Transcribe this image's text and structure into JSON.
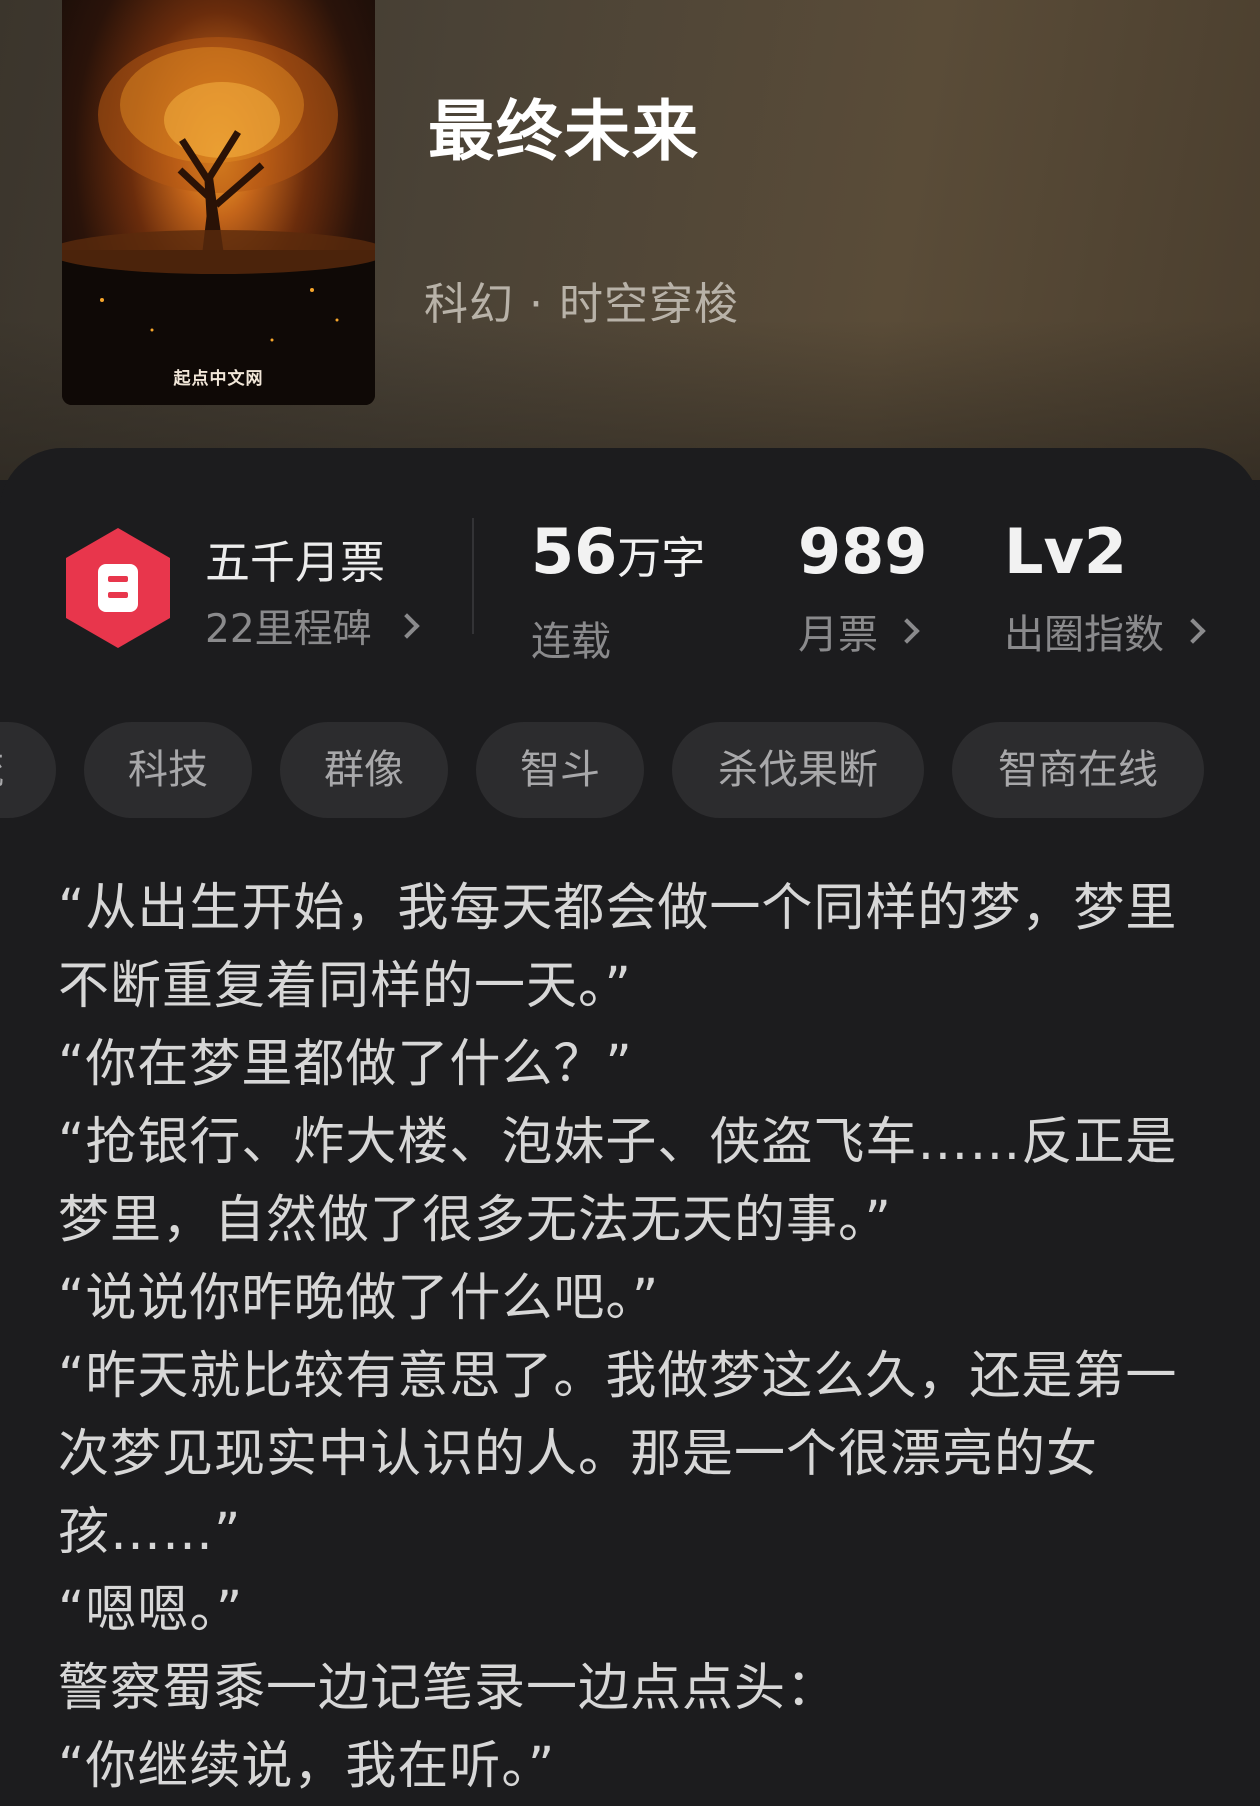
{
  "book": {
    "title": "最终未来",
    "genre": "科幻 · 时空穿梭",
    "cover_publisher": "起点中文网"
  },
  "ticket": {
    "name": "五千月票",
    "milestone": "22里程碑",
    "badge_color": "#e8364c"
  },
  "stats": {
    "words": {
      "value": "56",
      "unit": "万字",
      "label": "连载"
    },
    "monthly_tickets": {
      "value": "989",
      "label": "月票"
    },
    "breakout_index": {
      "value": "Lv2",
      "label": "出圈指数"
    }
  },
  "tags": [
    "流",
    "科技",
    "群像",
    "智斗",
    "杀伐果断",
    "智商在线"
  ],
  "blurb": [
    "“从出生开始，我每天都会做一个同样的梦，梦里不断重复着同样的一天。”",
    "“你在梦里都做了什么？”",
    "“抢银行、炸大楼、泡妹子、侠盗飞车……反正是梦里，自然做了很多无法无天的事。”",
    "“说说你昨晚做了什么吧。”",
    "“昨天就比较有意思了。我做梦这么久，还是第一次梦见现实中认识的人。那是一个很漂亮的女孩……”",
    "“嗯嗯。”",
    "警察蜀黍一边记笔录一边点点头：",
    "“你继续说，我在听。”"
  ]
}
